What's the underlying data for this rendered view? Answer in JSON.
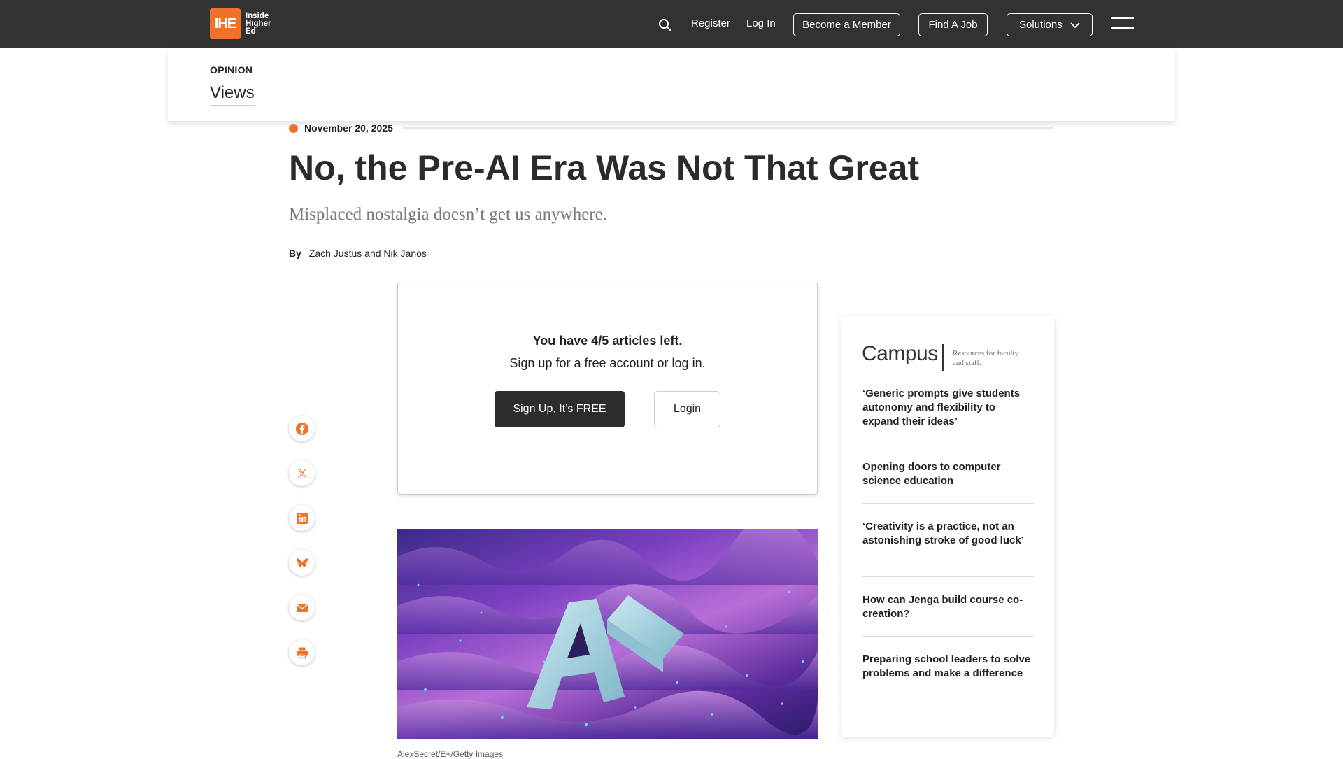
{
  "nav": {
    "logo_mark": "IHE",
    "logo_line1": "Inside",
    "logo_line2": "Higher",
    "logo_line3": "Ed",
    "register": "Register",
    "login": "Log In",
    "become_member": "Become a Member",
    "find_job": "Find A Job",
    "solutions": "Solutions"
  },
  "section": {
    "kicker": "OPINION",
    "title": "Views"
  },
  "article": {
    "date": "November 20, 2025",
    "headline": "No, the Pre-AI Era Was Not That Great",
    "dek": "Misplaced nostalgia doesn’t get us anywhere.",
    "byline_prefix": "By",
    "author1": "Zach Justus",
    "byline_and": "and",
    "author2": "Nik Janos",
    "image_caption": "AlexSecret/E+/Getty Images"
  },
  "paywall": {
    "line1": "You have 4/5 articles left.",
    "line2": "Sign up for a free account or log in.",
    "signup_label": "Sign Up, It’s FREE",
    "login_label": "Login"
  },
  "share": [
    "facebook-icon",
    "x-icon",
    "linkedin-icon",
    "bluesky-icon",
    "email-icon",
    "print-icon"
  ],
  "campus": {
    "brand": "Campus",
    "tagline": "Resources for faculty and staff.",
    "items": [
      "‘Generic prompts give students autonomy and flexibility to expand their ideas’",
      "Opening doors to computer science education",
      "‘Creativity is a practice, not an astonishing stroke of good luck’",
      "How can Jenga build course co-creation?",
      "Preparing school leaders to solve problems and make a difference"
    ]
  },
  "colors": {
    "accent": "#f0722a",
    "nav_bg": "#323232",
    "dark_button": "#2d2d2d"
  }
}
